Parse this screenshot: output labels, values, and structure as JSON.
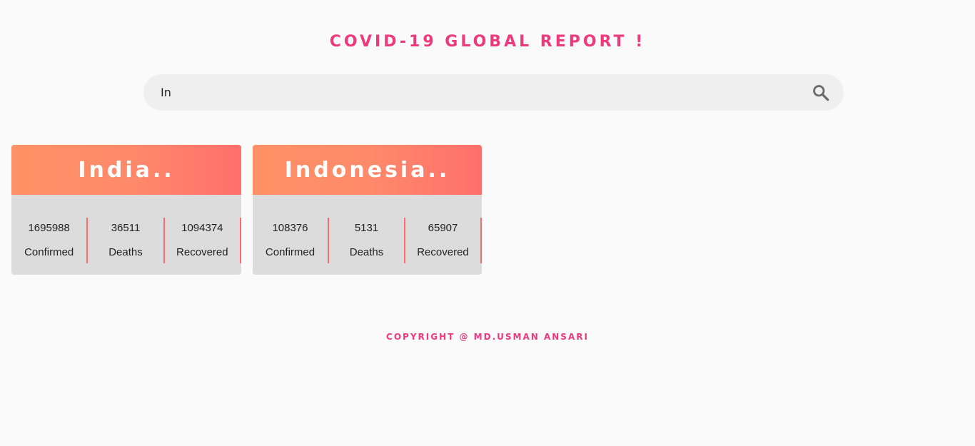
{
  "header": {
    "title": "COVID-19 GLOBAL REPORT !"
  },
  "search": {
    "value": "In",
    "icon": "search-icon"
  },
  "countries": [
    {
      "name": "India..",
      "confirmed": "1695988",
      "confirmed_label": "Confirmed",
      "deaths": "36511",
      "deaths_label": "Deaths",
      "recovered": "1094374",
      "recovered_label": "Recovered"
    },
    {
      "name": "Indonesia..",
      "confirmed": "108376",
      "confirmed_label": "Confirmed",
      "deaths": "5131",
      "deaths_label": "Deaths",
      "recovered": "65907",
      "recovered_label": "Recovered"
    }
  ],
  "footer": {
    "text": "COPYRIGHT @ MD.USMAN ANSARI"
  },
  "colors": {
    "accent": "#ec3a7c",
    "card_gradient_start": "#ff9166",
    "card_gradient_end": "#ff6f6c",
    "divider": "#ff6b6b",
    "card_body": "#dcdcdc"
  }
}
